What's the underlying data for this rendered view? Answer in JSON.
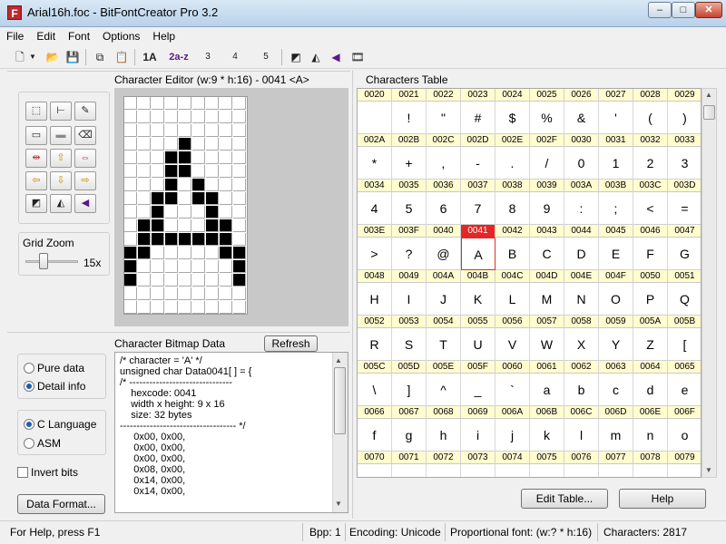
{
  "window": {
    "title": "Arial16h.foc - BitFontCreator Pro 3.2",
    "app_icon_letter": "F",
    "min": "–",
    "max": "□",
    "close": "✕"
  },
  "menu": [
    "File",
    "Edit",
    "Font",
    "Options",
    "Help"
  ],
  "toolbar": {
    "icons": [
      "new-file-icon",
      "dropdown-arrow-icon",
      "open-folder-icon",
      "save-icon",
      "copy-icon",
      "paste-icon",
      "font-size-icon",
      "lowercase-range-icon",
      "bitmap-list-icon",
      "import-icon",
      "export-icon",
      "invert-color-icon",
      "flip-icon",
      "mirror-icon",
      "film-icon"
    ],
    "labels": {
      "t1": "1A",
      "t2": "2a-z",
      "t3": "3",
      "t4": "4",
      "t5": "5"
    }
  },
  "editor": {
    "title": "Character Editor (w:9 * h:16) - 0041 <A>",
    "grid_zoom_label": "Grid Zoom",
    "zoom_value": "15x",
    "zoom_fraction": 0.35,
    "grid_width": 9,
    "grid_height": 16,
    "on_pixels": [
      [
        3,
        4
      ],
      [
        4,
        4
      ],
      [
        4,
        3
      ],
      [
        5,
        3
      ],
      [
        5,
        4
      ],
      [
        6,
        4
      ],
      [
        6,
        3
      ],
      [
        7,
        3
      ],
      [
        7,
        4
      ],
      [
        8,
        4
      ],
      [
        8,
        2
      ],
      [
        9,
        2
      ],
      [
        9,
        5
      ],
      [
        10,
        5
      ],
      [
        10,
        1
      ],
      [
        11,
        1
      ],
      [
        10,
        2
      ],
      [
        10,
        3
      ],
      [
        10,
        4
      ],
      [
        10,
        5
      ],
      [
        10,
        6
      ],
      [
        10,
        7
      ],
      [
        11,
        7
      ],
      [
        12,
        7
      ],
      [
        13,
        7
      ],
      [
        11,
        0
      ],
      [
        12,
        0
      ],
      [
        13,
        0
      ],
      [
        9,
        6
      ],
      [
        8,
        6
      ],
      [
        7,
        5
      ],
      [
        6,
        5
      ],
      [
        5,
        5
      ],
      [
        4,
        5
      ]
    ]
  },
  "bitmap_data": {
    "title": "Character Bitmap Data",
    "refresh": "Refresh",
    "text": "/* character = 'A' */\nunsigned char Data0041[ ] = {\n/* -------------------------------\n    hexcode: 0041\n    width x height: 9 x 16\n    size: 32 bytes\n----------------------------------- */\n     0x00, 0x00,\n     0x00, 0x00,\n     0x00, 0x00,\n     0x08, 0x00,\n     0x14, 0x00,\n     0x14, 0x00,",
    "pure_data": "Pure data",
    "detail_info": "Detail info",
    "c_language": "C Language",
    "asm": "ASM",
    "invert_bits": "Invert bits",
    "data_format": "Data Format..."
  },
  "table": {
    "title": "Characters Table",
    "edit_table": "Edit Table...",
    "help": "Help",
    "selected_code": "0041",
    "rows": [
      {
        "codes": [
          "0020",
          "0021",
          "0022",
          "0023",
          "0024",
          "0025",
          "0026",
          "0027",
          "0028",
          "0029"
        ],
        "chars": [
          " ",
          "!",
          "\"",
          "#",
          "$",
          "%",
          "&",
          "'",
          "(",
          ")"
        ]
      },
      {
        "codes": [
          "002A",
          "002B",
          "002C",
          "002D",
          "002E",
          "002F",
          "0030",
          "0031",
          "0032",
          "0033"
        ],
        "chars": [
          "*",
          "+",
          ",",
          "-",
          ".",
          "/",
          "0",
          "1",
          "2",
          "3"
        ]
      },
      {
        "codes": [
          "0034",
          "0035",
          "0036",
          "0037",
          "0038",
          "0039",
          "003A",
          "003B",
          "003C",
          "003D"
        ],
        "chars": [
          "4",
          "5",
          "6",
          "7",
          "8",
          "9",
          ":",
          ";",
          "<",
          "="
        ]
      },
      {
        "codes": [
          "003E",
          "003F",
          "0040",
          "0041",
          "0042",
          "0043",
          "0044",
          "0045",
          "0046",
          "0047"
        ],
        "chars": [
          ">",
          "?",
          "@",
          "A",
          "B",
          "C",
          "D",
          "E",
          "F",
          "G"
        ]
      },
      {
        "codes": [
          "0048",
          "0049",
          "004A",
          "004B",
          "004C",
          "004D",
          "004E",
          "004F",
          "0050",
          "0051"
        ],
        "chars": [
          "H",
          "I",
          "J",
          "K",
          "L",
          "M",
          "N",
          "O",
          "P",
          "Q"
        ]
      },
      {
        "codes": [
          "0052",
          "0053",
          "0054",
          "0055",
          "0056",
          "0057",
          "0058",
          "0059",
          "005A",
          "005B"
        ],
        "chars": [
          "R",
          "S",
          "T",
          "U",
          "V",
          "W",
          "X",
          "Y",
          "Z",
          "["
        ]
      },
      {
        "codes": [
          "005C",
          "005D",
          "005E",
          "005F",
          "0060",
          "0061",
          "0062",
          "0063",
          "0064",
          "0065"
        ],
        "chars": [
          "\\",
          "]",
          "^",
          "_",
          "`",
          "a",
          "b",
          "c",
          "d",
          "e"
        ]
      },
      {
        "codes": [
          "0066",
          "0067",
          "0068",
          "0069",
          "006A",
          "006B",
          "006C",
          "006D",
          "006E",
          "006F"
        ],
        "chars": [
          "f",
          "g",
          "h",
          "i",
          "j",
          "k",
          "l",
          "m",
          "n",
          "o"
        ]
      },
      {
        "codes": [
          "0070",
          "0071",
          "0072",
          "0073",
          "0074",
          "0075",
          "0076",
          "0077",
          "0078",
          "0079"
        ],
        "chars": [
          "",
          "",
          "",
          "",
          "",
          "",
          "",
          "",
          "",
          ""
        ]
      }
    ]
  },
  "status": {
    "help": "For Help, press F1",
    "bpp": "Bpp: 1",
    "encoding": "Encoding: Unicode",
    "font_type": "Proportional font: (w:? * h:16)",
    "characters": "Characters: 2817"
  }
}
